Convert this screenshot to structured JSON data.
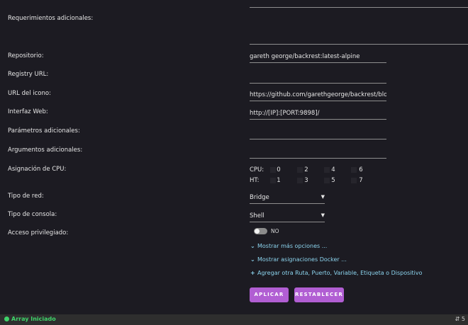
{
  "labels": {
    "requerimientos": "Requerimientos adicionales:",
    "repositorio": "Repositorio:",
    "registry": "Registry URL:",
    "icono": "URL del icono:",
    "interfaz": "Interfaz Web:",
    "parametros": "Parámetros adicionales:",
    "argumentos": "Argumentos adicionales:",
    "cpu": "Asignación de CPU:",
    "tipo_red": "Tipo de red:",
    "tipo_consola": "Tipo de consola:",
    "privilegiado": "Acceso privilegiado:"
  },
  "fields": {
    "repositorio": "gareth george/backrest:latest-alpine",
    "registry": "",
    "icono": "https://github.com/garethgeorge/backrest/blob/m",
    "interfaz": "http://[IP]:[PORT:9898]/",
    "parametros": "",
    "argumentos": ""
  },
  "cpu": {
    "cpu_label": "CPU:",
    "ht_label": "HT:",
    "cpu_row": [
      "0",
      "2",
      "4",
      "6"
    ],
    "ht_row": [
      "1",
      "3",
      "5",
      "7"
    ]
  },
  "selects": {
    "tipo_red": "Bridge",
    "tipo_consola": "Shell"
  },
  "toggle": {
    "privilegiado_state": "NO"
  },
  "links": {
    "mostrar_opciones": "Mostrar más opciones ...",
    "mostrar_asignaciones": "Mostrar asignaciones Docker ...",
    "agregar": "Agregar otra Ruta, Puerto, Variable, Etiqueta o Dispositivo"
  },
  "buttons": {
    "aplicar": "APLICAR",
    "restablecer": "RESTABLECER"
  },
  "footer": {
    "status": "Array Iniciado",
    "right": "⇵ 5"
  },
  "colors": {
    "background": "#1c1b22",
    "accent_button": "#b15ed3",
    "link": "#8cd4ee",
    "status_green": "#3fd36a"
  }
}
